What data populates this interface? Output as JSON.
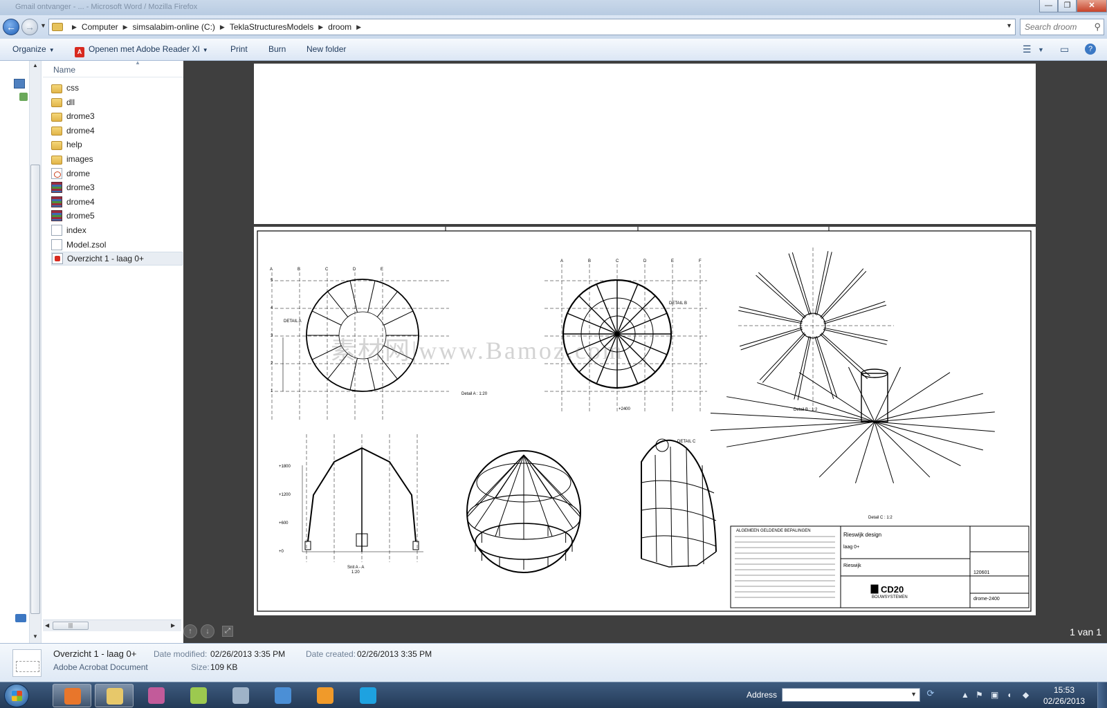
{
  "window": {
    "title": "Gmail ontvanger - ... - Microsoft Word / Mozilla Firefox",
    "minimize_label": "—",
    "maximize_label": "❐",
    "close_label": "✕"
  },
  "address": {
    "crumbs": [
      "Computer",
      "simsalabim-online (C:)",
      "TeklaStructuresModels",
      "droom"
    ],
    "refresh_icon": "refresh-icon"
  },
  "search": {
    "placeholder": "Search droom"
  },
  "toolbar": {
    "organize_label": "Organize",
    "open_with_label": "Openen met Adobe Reader XI",
    "print_label": "Print",
    "burn_label": "Burn",
    "new_folder_label": "New folder"
  },
  "filelist": {
    "column_name": "Name",
    "items": [
      {
        "name": "css",
        "type": "folder"
      },
      {
        "name": "dll",
        "type": "folder"
      },
      {
        "name": "drome3",
        "type": "folder"
      },
      {
        "name": "drome4",
        "type": "folder"
      },
      {
        "name": "help",
        "type": "folder"
      },
      {
        "name": "images",
        "type": "folder"
      },
      {
        "name": "drome",
        "type": "html"
      },
      {
        "name": "drome3",
        "type": "rar"
      },
      {
        "name": "drome4",
        "type": "rar"
      },
      {
        "name": "drome5",
        "type": "rar"
      },
      {
        "name": "index",
        "type": "doc"
      },
      {
        "name": "Model.zsol",
        "type": "doc"
      },
      {
        "name": "Overzicht 1 - laag 0+",
        "type": "pdf",
        "selected": true
      }
    ]
  },
  "preview": {
    "page_count": "1 van 1",
    "watermark": "素材网|www.Bamoz.com",
    "drawing": {
      "detail_a": "Detail A : 1:20",
      "detail_b": "Detail B : 1:2",
      "detail_c": "Detail C : 1:2",
      "detail_a_label": "DETAIL A",
      "detail_b_label": "DETAIL B",
      "detail_c_label": "DETAIL C",
      "section_label": "Snit A - A",
      "scale_label": "1:20",
      "plan_label": "+2400",
      "company": "CD20",
      "company_sub": "BOUWSYSTEMEN",
      "project": "Rieswijk design",
      "level": "laag 0+",
      "client": "Rieswijk",
      "number": "120601",
      "drawing_name": "drome-2400",
      "notes_header": "ALGEMEEN GELDENDE BEPALINGEN",
      "plan_cols": [
        "A",
        "B",
        "C",
        "D",
        "E"
      ],
      "plan_cols_b": [
        "A",
        "B",
        "C",
        "D",
        "E",
        "F"
      ],
      "plan_rows": [
        "5",
        "4",
        "3",
        "2",
        "1"
      ],
      "levels": [
        "+1800",
        "+1200",
        "+600",
        "+0"
      ]
    }
  },
  "details": {
    "file_name": "Overzicht 1 - laag 0+",
    "file_type": "Adobe Acrobat Document",
    "date_modified_label": "Date modified:",
    "date_modified": "02/26/2013 3:35 PM",
    "date_created_label": "Date created:",
    "date_created": "02/26/2013 3:35 PM",
    "size_label": "Size:",
    "size": "109 KB"
  },
  "taskbar": {
    "address_label": "Address",
    "time": "15:53",
    "date": "02/26/2013",
    "apps": [
      {
        "name": "firefox",
        "color": "#e8762b"
      },
      {
        "name": "explorer",
        "color": "#e7c86a"
      },
      {
        "name": "paint",
        "color": "#c25b9a"
      },
      {
        "name": "notes",
        "color": "#9cc94f"
      },
      {
        "name": "calculator",
        "color": "#9fb3c8"
      },
      {
        "name": "publisher",
        "color": "#4b8fd6"
      },
      {
        "name": "media-player",
        "color": "#f09a2a"
      },
      {
        "name": "skype",
        "color": "#1ea2e0"
      }
    ]
  }
}
